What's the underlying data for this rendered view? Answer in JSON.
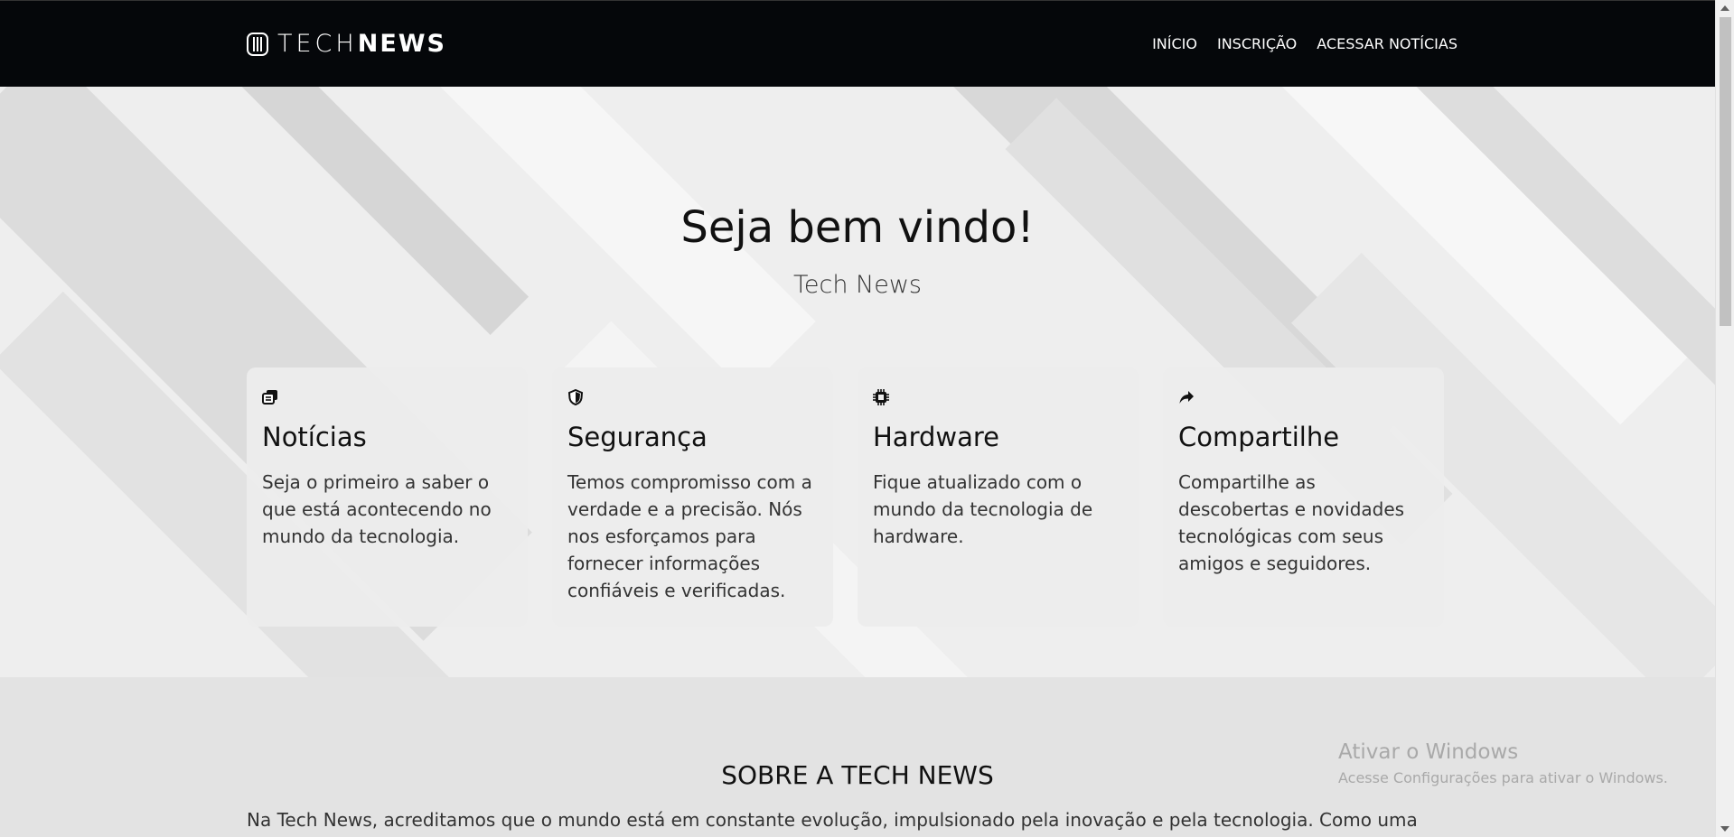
{
  "header": {
    "brand_light": "TECH",
    "brand_bold": "NEWS",
    "nav": [
      "INÍCIO",
      "INSCRIÇÃO",
      "ACESSAR NOTÍCIAS"
    ]
  },
  "hero": {
    "title": "Seja bem vindo!",
    "subtitle": "Tech News"
  },
  "cards": [
    {
      "icon": "newspaper-icon",
      "title": "Notícias",
      "text": "Seja o primeiro a saber o que está acontecendo no mundo da tecnologia."
    },
    {
      "icon": "shield-icon",
      "title": "Segurança",
      "text": "Temos compromisso com a verdade e a precisão. Nós nos esforçamos para fornecer informações confiáveis e verificadas."
    },
    {
      "icon": "chip-icon",
      "title": "Hardware",
      "text": "Fique atualizado com o mundo da tecnologia de hardware."
    },
    {
      "icon": "share-icon",
      "title": "Compartilhe",
      "text": "Compartilhe as descobertas e novidades tecnológicas com seus amigos e seguidores."
    }
  ],
  "about": {
    "title": "SOBRE A TECH NEWS",
    "text": "Na Tech News, acreditamos que o mundo está em constante evolução, impulsionado pela inovação e pela tecnologia. Como uma"
  },
  "watermark": {
    "title": "Ativar o Windows",
    "subtitle": "Acesse Configurações para ativar o Windows."
  },
  "colors": {
    "navbar_bg": "#05070a",
    "hero_bg": "#eeeeee",
    "card_bg": "#ececec",
    "about_bg": "#e3e3e3"
  }
}
